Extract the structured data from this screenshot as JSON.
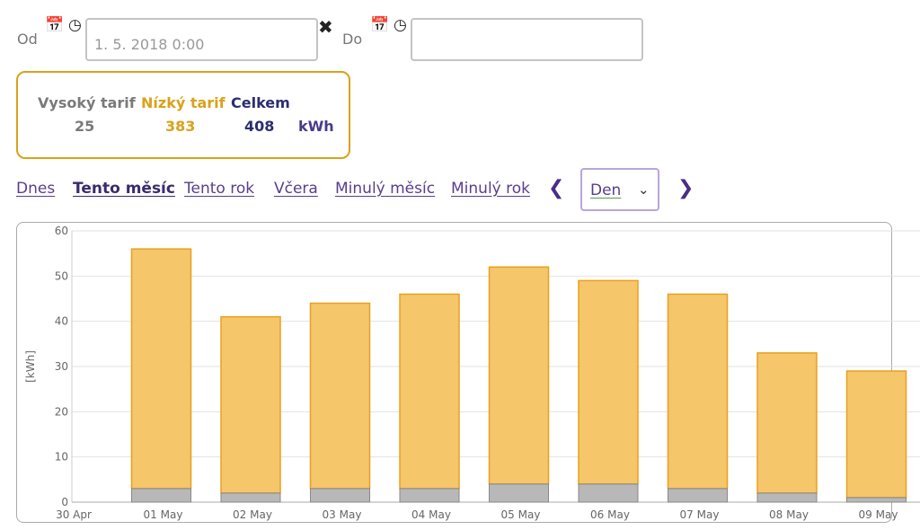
{
  "filter": {
    "from_label": "Od",
    "from_value": "1. 5. 2018 0:00",
    "to_label": "Do",
    "to_value": "",
    "calendar_icon": "calendar-icon",
    "clock_icon": "clock-icon",
    "clear_icon": "close-icon"
  },
  "summary": {
    "high_label": "Vysoký tarif",
    "low_label": "Nízký tarif",
    "total_label": "Celkem",
    "high_value": "25",
    "low_value": "383",
    "total_value": "408",
    "unit": "kWh"
  },
  "nav": {
    "links": [
      "Dnes",
      "Tento měsíc",
      "Tento rok",
      "Včera",
      "Minulý měsíc",
      "Minulý rok"
    ],
    "active": "Tento měsíc",
    "prev_icon": "chevron-left-icon",
    "next_icon": "chevron-right-icon",
    "granularity_value": "Den"
  },
  "colors": {
    "low_tariff": "#f5c66a",
    "low_tariff_border": "#e8a020",
    "high_tariff": "#b8b8b8",
    "high_tariff_border": "#888888",
    "accent": "#4a2d86",
    "summary_border": "#d9a21b"
  },
  "chart_data": {
    "type": "bar",
    "stacked": true,
    "ylabel": "[kWh]",
    "ylim": [
      0,
      60
    ],
    "yticks": [
      0,
      10,
      20,
      30,
      40,
      50,
      60
    ],
    "xtick_labels": [
      "30 Apr",
      "01 May",
      "02 May",
      "03 May",
      "04 May",
      "05 May",
      "06 May",
      "07 May",
      "08 May",
      "09 May"
    ],
    "categories": [
      "01 May",
      "02 May",
      "03 May",
      "04 May",
      "05 May",
      "06 May",
      "07 May",
      "08 May",
      "09 May"
    ],
    "series": [
      {
        "key": "high",
        "values": [
          3,
          2,
          3,
          3,
          4,
          4,
          3,
          2,
          1
        ]
      },
      {
        "key": "low",
        "values": [
          53,
          39,
          41,
          43,
          48,
          45,
          43,
          31,
          28
        ]
      }
    ],
    "grid": true
  }
}
